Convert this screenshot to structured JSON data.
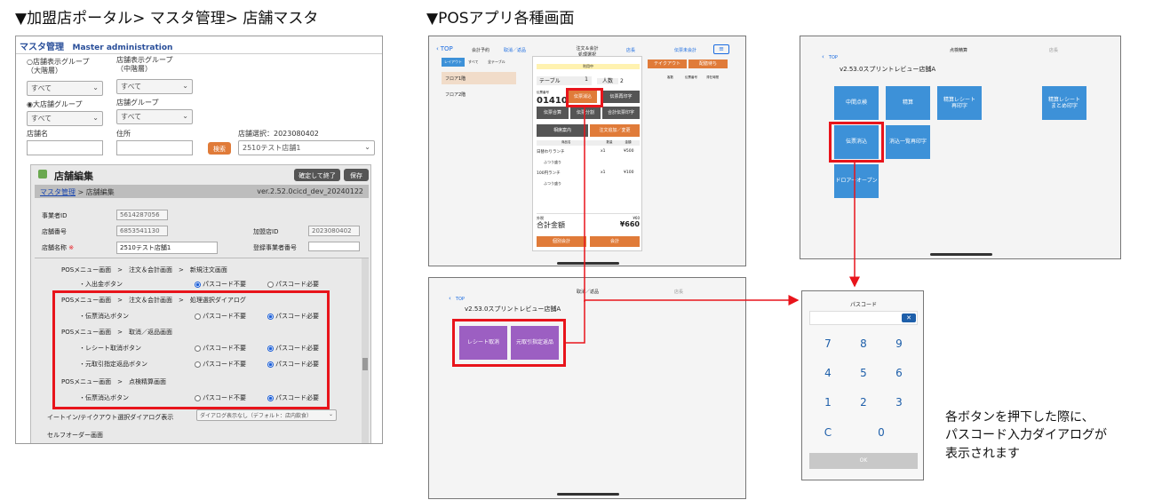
{
  "captions": {
    "portal": "▼加盟店ポータル> マスタ管理> 店舗マスタ",
    "pos": "▼POSアプリ各種画面"
  },
  "portal": {
    "header_title": "マスタ管理",
    "header_sub": "Master administration",
    "filters": {
      "display_group_large_label": "○店舗表示グループ\n（大階層）",
      "display_group_mid_label": "店舗表示グループ\n（中階層）",
      "all1": "すべて",
      "all2": "すべて",
      "large_store_group_label": "◉大店舗グループ",
      "store_group_label": "店舗グループ",
      "all3": "すべて",
      "all4": "すべて",
      "store_name_label": "店舗名",
      "address_label": "住所",
      "search_button": "検索",
      "store_select_label": "店舗選択：2023080402",
      "store_select_value": "2510テスト店舗1"
    },
    "editor": {
      "title": "店舗編集",
      "confirm_button": "確定して終了",
      "save_button": "保存",
      "crumb_link": "マスタ管理",
      "crumb_rest": " > 店舗編集",
      "version": "ver.2.52.0cicd_dev_20240122",
      "business_id_label": "事業者ID",
      "business_id_value": "5614287056",
      "store_no_label": "店舗番号",
      "store_no_value": "6853541130",
      "member_id_label": "加盟店ID",
      "member_id_value": "2023080402",
      "store_name_label": "店舗名称",
      "required_mark": "※",
      "store_name_value": "2510テスト店舗1",
      "reg_no_label": "登録事業者番号"
    },
    "settings": [
      {
        "path": "POSメニュー画面　>　注文＆会計画面　>　新規注文画面",
        "item": "・入出金ボタン",
        "opt1": "パスコード不要",
        "opt2": "パスコード必要",
        "selected": 1
      },
      {
        "path": "POSメニュー画面　>　注文＆会計画面　>　処理選択ダイアログ",
        "item": "・伝票消込ボタン",
        "opt1": "パスコード不要",
        "opt2": "パスコード必要",
        "selected": 2
      },
      {
        "path": "POSメニュー画面　>　取消／返品画面",
        "item": "・レシート取消ボタン",
        "opt1": "パスコード不要",
        "opt2": "パスコード必要",
        "selected": 2
      },
      {
        "path": "",
        "item": "・元取引指定返品ボタン",
        "opt1": "パスコード不要",
        "opt2": "パスコード必要",
        "selected": 2
      },
      {
        "path": "POSメニュー画面　>　点検精算画面",
        "item": "・伝票消込ボタン",
        "opt1": "パスコード不要",
        "opt2": "パスコード必要",
        "selected": 2
      }
    ],
    "eatin_label": "イートイン/テイクアウト選択ダイアログ表示",
    "eatin_value": "ダイアログ表示なし（デフォルト：店内飲食）",
    "self_order_label": "セルフオーダー画面"
  },
  "pos_order": {
    "nav_top": "TOP",
    "nav_reserve": "会計予約",
    "nav_cancel": "取消／返品",
    "title": "注文＆会計",
    "subtitle": "処理選択",
    "nav_user": "店長",
    "nav_unpaid": "伝票未会計",
    "tab_layout": "レイアウト",
    "tab_all": "すべて",
    "tab_table": "全テーブル",
    "tab_seat": "配膳待ち",
    "floor1": "フロア1階",
    "floor2": "フロア2階",
    "status": "利用中",
    "table_label": "テーブル",
    "table_value": "1",
    "people_label": "人数",
    "people_value": "2",
    "slip_no_label": "伝票番号",
    "slip_no": "01410",
    "clear_slip": "伝票消込",
    "reprint": "伝票再印字",
    "merge": "伝票合算",
    "split": "伝票分割",
    "total_print": "合計伝票印字",
    "guide": "相席案内",
    "add_order": "注文追加／変更",
    "takeout": "テイクアウト",
    "wait": "配膳待ち",
    "col_name": "商品名",
    "col_qty": "数量",
    "col_amt": "金額",
    "item1": "日替わりランチ",
    "item1_qty": "x1",
    "item1_amt": "¥500",
    "item1_sub": "ふつう盛り",
    "item2": "100円ランチ",
    "item2_qty": "x1",
    "item2_amt": "¥100",
    "item2_sub": "ふつう盛り",
    "tax_label": "外税",
    "tax_value": "¥60",
    "total_label": "合計金額",
    "total_value": "¥660",
    "pay_split": "個別会計",
    "pay": "会計",
    "col_count": "客数",
    "col_store": "伝票番号",
    "col_time": "滞在時間"
  },
  "pos_check": {
    "nav_top": "TOP",
    "title": "点検精算",
    "user": "店長",
    "store": "v2.53.0スプリントレビュー店舗A",
    "tiles": [
      "中間点検",
      "精算",
      "精算レシート\n再印字",
      "精算レシート\nまとめ印字",
      "伝票消込",
      "消込一覧再印字",
      "ドロアーオープン"
    ]
  },
  "pos_return": {
    "nav_top": "TOP",
    "title": "取消／返品",
    "user": "店長",
    "store": "v2.53.0スプリントレビュー店舗A",
    "receipt_cancel": "レシート取消",
    "original_return": "元取引指定返品"
  },
  "passcode": {
    "title": "パスコード",
    "keys": [
      "7",
      "8",
      "9",
      "4",
      "5",
      "6",
      "1",
      "2",
      "3",
      "C",
      "0"
    ],
    "ok": "OK"
  },
  "note": "各ボタンを押下した際に、\nパスコード入力ダイアログが\n表示されます",
  "colors": {
    "red": "#e8141b",
    "orange": "#e07b39",
    "blue": "#3d91d8",
    "purple": "#9c5fc2"
  }
}
